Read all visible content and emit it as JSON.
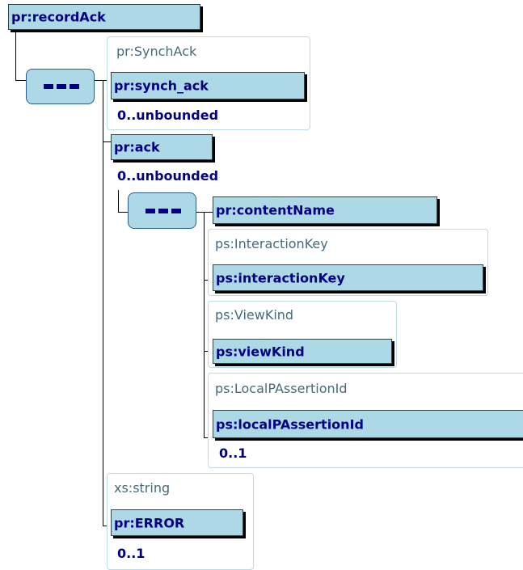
{
  "diagram": {
    "root": {
      "label": "pr:recordAck"
    },
    "synch_type": {
      "label": "pr:SynchAck"
    },
    "synch_ack": {
      "label": "pr:synch_ack",
      "cardinality": "0..unbounded"
    },
    "ack": {
      "label": "pr:ack",
      "cardinality": "0..unbounded"
    },
    "content_name": {
      "label": "pr:contentName"
    },
    "interaction_key_type": {
      "label": "ps:InteractionKey"
    },
    "interaction_key": {
      "label": "ps:interactionKey"
    },
    "view_kind_type": {
      "label": "ps:ViewKind"
    },
    "view_kind": {
      "label": "ps:viewKind"
    },
    "local_id_type": {
      "label": "ps:LocalPAssertionId"
    },
    "local_id": {
      "label": "ps:localPAssertionId",
      "cardinality": "0..1"
    },
    "error_type": {
      "label": "xs:string"
    },
    "error": {
      "label": "pr:ERROR",
      "cardinality": "0..1"
    }
  },
  "colors": {
    "element_fill": "#add8e6",
    "element_text": "#000080",
    "type_text": "#466a7a",
    "type_border": "#bcdbe6"
  },
  "icons": {
    "sequence": "sequence-compositor-icon"
  }
}
